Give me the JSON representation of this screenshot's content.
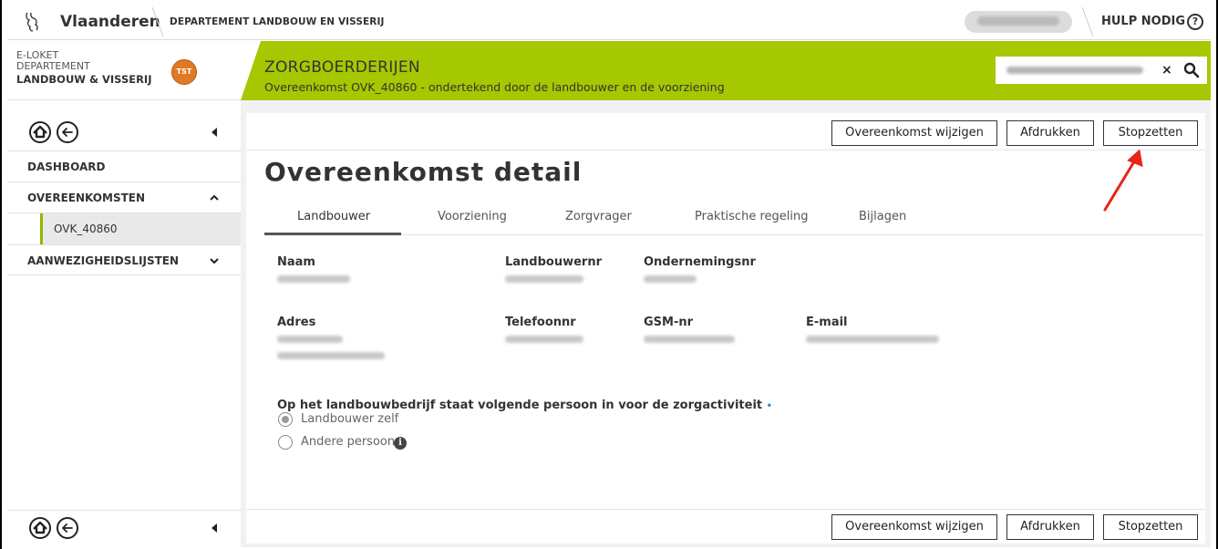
{
  "topbar": {
    "brand": "Vlaanderen",
    "department": "DEPARTEMENT LANDBOUW EN VISSERIJ",
    "help": "HULP NODIG",
    "help_icon": "?"
  },
  "eloket": {
    "line1": "E-LOKET",
    "line2": "DEPARTEMENT",
    "line3": "LANDBOUW & VISSERIJ",
    "badge": "TST"
  },
  "header": {
    "title": "ZORGBOERDERIJEN",
    "subtitle": "Overeenkomst OVK_40860 - ondertekend door de landbouwer en de voorziening",
    "search_clear": "×"
  },
  "sidebar": {
    "items": [
      {
        "label": "DASHBOARD"
      },
      {
        "label": "OVEREENKOMSTEN"
      },
      {
        "label": "OVK_40860"
      },
      {
        "label": "AANWEZIGHEIDSLIJSTEN"
      }
    ]
  },
  "actions": {
    "edit": "Overeenkomst wijzigen",
    "print": "Afdrukken",
    "stop": "Stopzetten"
  },
  "page": {
    "title": "Overeenkomst detail"
  },
  "tabs": [
    {
      "label": "Landbouwer",
      "active": true
    },
    {
      "label": "Voorziening"
    },
    {
      "label": "Zorgvrager"
    },
    {
      "label": "Praktische regeling"
    },
    {
      "label": "Bijlagen"
    }
  ],
  "fields": {
    "naam": "Naam",
    "landbouwernr": "Landbouwernr",
    "ondernemingsnr": "Ondernemingsnr",
    "adres": "Adres",
    "telefoonnr": "Telefoonnr",
    "gsm": "GSM-nr",
    "email": "E-mail"
  },
  "question": {
    "label": "Op het landbouwbedrijf staat volgende persoon in voor de zorgactiviteit",
    "required_mark": "•",
    "options": [
      {
        "label": "Landbouwer zelf",
        "selected": true
      },
      {
        "label": "Andere persoon",
        "selected": false
      }
    ],
    "info_icon": "i"
  },
  "colors": {
    "accent_green": "#a5c800",
    "badge_orange": "#e27924",
    "annotation_arrow": "#e8231a"
  }
}
